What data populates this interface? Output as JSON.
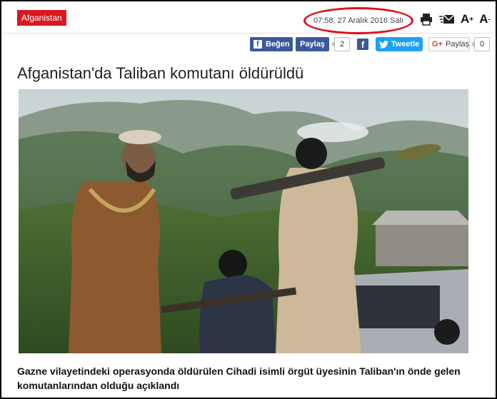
{
  "header": {
    "category": "Afganistan",
    "date": "07:58, 27 Aralık 2016 Salı",
    "font_increase": "A",
    "font_decrease": "A",
    "font_increase_sign": "+",
    "font_decrease_sign": "-"
  },
  "share": {
    "facebook_like": "Beğen",
    "facebook_share": "Paylaş",
    "facebook_share_count": "2",
    "tweet": "Tweetle",
    "google_share": "Paylaş",
    "google_share_count": "0",
    "google_prefix": "G+"
  },
  "article": {
    "title": "Afganistan'da Taliban komutanı öldürüldü",
    "caption": "Gazne vilayetindeki operasyonda öldürülen Cihadi isimli örgüt üyesinin Taliban'ın önde gelen komutanlarından olduğu açıklandı"
  },
  "colors": {
    "category_bg": "#d8191f",
    "highlight_ring": "#e0101a",
    "facebook": "#3b5998",
    "twitter": "#1da1f2"
  }
}
